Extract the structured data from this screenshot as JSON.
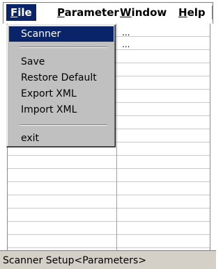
{
  "menubar": {
    "items": [
      "File",
      "Parameter",
      "Window",
      "Help"
    ]
  },
  "file_menu": {
    "items": [
      {
        "label": "Scanner",
        "selected": true
      },
      {
        "label": "Save"
      },
      {
        "label": "Restore Default"
      },
      {
        "label": "Export XML"
      },
      {
        "label": "Import XML"
      },
      {
        "label": "exit"
      }
    ]
  },
  "grid": {
    "cell_values": [
      "...",
      "..."
    ]
  },
  "status": {
    "text": "Scanner Setup<Parameters>"
  }
}
